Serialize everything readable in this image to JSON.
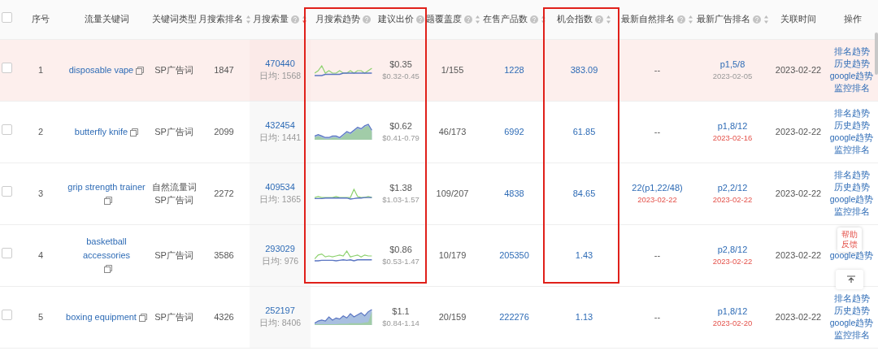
{
  "header_checkbox": {
    "checked": false
  },
  "table": {
    "columns": [
      {
        "label": "序号"
      },
      {
        "label": "流量关键词"
      },
      {
        "label": "关键词类型"
      },
      {
        "label": "月搜索排名",
        "sortable": true,
        "sorted_desc": false
      },
      {
        "label": "月搜索量",
        "help": true,
        "sortable": true,
        "sorted_desc": true
      },
      {
        "label": "月搜索趋势",
        "help": true,
        "framed": true
      },
      {
        "label": "建议出价",
        "help": true,
        "framed": true
      },
      {
        "label": "题覆盖度",
        "help": true,
        "sortable": true,
        "sorted_desc": false
      },
      {
        "label": "在售产品数",
        "help": true,
        "sortable": true,
        "sorted_desc": false
      },
      {
        "label": "机会指数",
        "help": true,
        "sortable": true,
        "sorted_desc": false,
        "framed": true
      },
      {
        "label": "最新自然排名",
        "help": true,
        "sortable": true,
        "sorted_desc": false
      },
      {
        "label": "最新广告排名",
        "help": true,
        "sortable": true,
        "sorted_desc": false
      },
      {
        "label": "关联时间"
      },
      {
        "label": "操作"
      }
    ],
    "rows": [
      {
        "selected": true,
        "checked": false,
        "index": "1",
        "keyword": "disposable vape",
        "types": [
          "SP广告词"
        ],
        "rank": "1847",
        "volume": "470440",
        "daily": "日均: 1568",
        "trend_filled": false,
        "bid": "$0.35",
        "bid_range": "$0.32-0.45",
        "coverage": "1/155",
        "products": "1228",
        "opportunity": "383.09",
        "natural_rank": "--",
        "ad_rank": "p1,5/8",
        "ad_date": "2023-02-05",
        "ad_date_red": false,
        "time": "2023-02-22",
        "actions": [
          "排名趋势",
          "历史趋势",
          "google趋势",
          "监控排名"
        ]
      },
      {
        "selected": false,
        "checked": false,
        "index": "2",
        "keyword": "butterfly knife",
        "types": [
          "SP广告词"
        ],
        "rank": "2099",
        "volume": "432454",
        "daily": "日均: 1441",
        "trend_filled": true,
        "bid": "$0.62",
        "bid_range": "$0.41-0.79",
        "coverage": "46/173",
        "products": "6992",
        "opportunity": "61.85",
        "natural_rank": "--",
        "ad_rank": "p1,8/12",
        "ad_date": "2023-02-16",
        "ad_date_red": true,
        "time": "2023-02-22",
        "actions": [
          "排名趋势",
          "历史趋势",
          "google趋势",
          "监控排名"
        ]
      },
      {
        "selected": false,
        "checked": false,
        "index": "3",
        "keyword": "grip strength trainer",
        "types": [
          "自然流量词",
          "SP广告词"
        ],
        "rank": "2272",
        "volume": "409534",
        "daily": "日均: 1365",
        "trend_filled": false,
        "bid": "$1.38",
        "bid_range": "$1.03-1.57",
        "coverage": "109/207",
        "products": "4838",
        "opportunity": "84.65",
        "natural_rank": "22(p1,22/48)",
        "natural_date": "2023-02-22",
        "ad_rank": "p2,2/12",
        "ad_date": "2023-02-22",
        "ad_date_red": true,
        "time": "2023-02-22",
        "actions": [
          "排名趋势",
          "历史趋势",
          "google趋势",
          "监控排名"
        ]
      },
      {
        "selected": false,
        "checked": false,
        "index": "4",
        "keyword": "basketball accessories",
        "types": [
          "SP广告词"
        ],
        "rank": "3586",
        "volume": "293029",
        "daily": "日均: 976",
        "trend_filled": false,
        "bid": "$0.86",
        "bid_range": "$0.53-1.47",
        "coverage": "10/179",
        "products": "205350",
        "opportunity": "1.43",
        "natural_rank": "--",
        "ad_rank": "p2,8/12",
        "ad_date": "2023-02-22",
        "ad_date_red": true,
        "time": "2023-02-22",
        "actions": [
          "google趋势"
        ]
      },
      {
        "selected": false,
        "checked": false,
        "index": "5",
        "keyword": "boxing equipment",
        "types": [
          "SP广告词"
        ],
        "rank": "4326",
        "volume": "252197",
        "daily": "日均: 8406",
        "trend_filled": true,
        "bid": "$1.1",
        "bid_range": "$0.84-1.14",
        "coverage": "20/159",
        "products": "222276",
        "opportunity": "1.13",
        "natural_rank": "--",
        "ad_rank": "p1,8/12",
        "ad_date": "2023-02-20",
        "ad_date_red": true,
        "time": "2023-02-22",
        "actions": [
          "排名趋势",
          "历史趋势",
          "google趋势",
          "监控排名"
        ]
      }
    ]
  },
  "help_widget": {
    "label": "帮助反馈"
  }
}
